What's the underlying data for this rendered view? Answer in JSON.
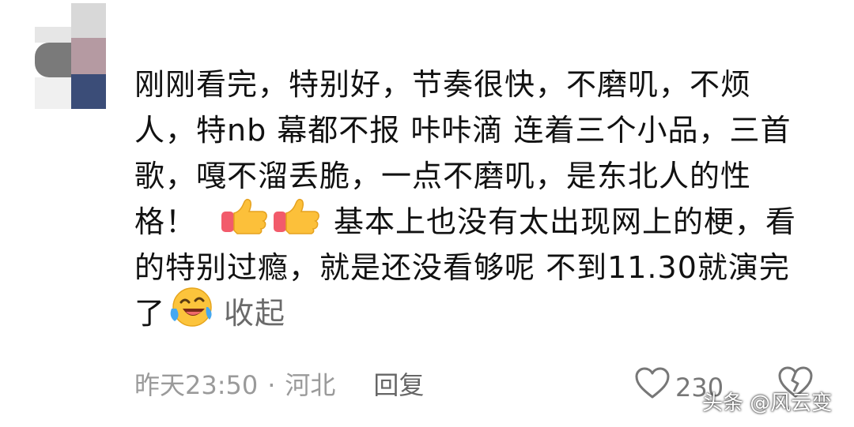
{
  "comment": {
    "lines": [
      "刚刚看完，特别好，节奏很快，不磨叽，不烦",
      "人，特nb 幕都不报 咔咔滴 连着三个小品，三首",
      "歌，嘎不溜丢脆，一点不磨叽，是东北人的性",
      "格！",
      " 基本上也没有太出现网上的梗，看",
      "的特别过瘾，就是还没看够呢 不到11.30就演完",
      "了"
    ],
    "collapse_label": "收起",
    "emojis": [
      "thumbs-up-icon",
      "thumbs-up-icon",
      "laughing-crying-icon"
    ]
  },
  "meta": {
    "time": "昨天23:50",
    "separator": "·",
    "location": "河北",
    "reply_label": "回复"
  },
  "actions": {
    "like_count": "230"
  },
  "watermark": {
    "text": "头条 @风云变"
  },
  "colors": {
    "text": "#111111",
    "muted": "#9a9a9a",
    "avatar_gray": "#7a7a7a",
    "avatar_pink": "#b59aa2",
    "avatar_navy": "#3b4d78"
  }
}
